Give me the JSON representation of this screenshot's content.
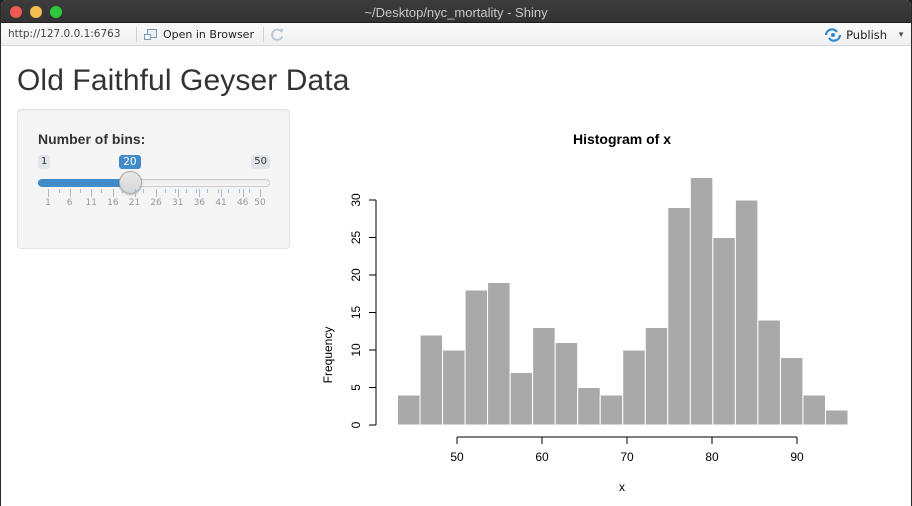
{
  "window": {
    "title": "~/Desktop/nyc_mortality - Shiny"
  },
  "toolbar": {
    "url": "http://127.0.0.1:6763",
    "open_in_browser_label": "Open in Browser",
    "publish_label": "Publish"
  },
  "page": {
    "title": "Old Faithful Geyser Data"
  },
  "slider": {
    "label": "Number of bins:",
    "min": 1,
    "max": 50,
    "value": 20,
    "min_label": "1",
    "max_label": "50",
    "value_label": "20",
    "tick_labels": [
      "1",
      "6",
      "11",
      "16",
      "21",
      "26",
      "31",
      "36",
      "41",
      "46",
      "50"
    ],
    "accent_color": "#428bca"
  },
  "chart_data": {
    "type": "bar",
    "title": "Histogram of x",
    "xlabel": "x",
    "ylabel": "Frequency",
    "bin_edges": [
      43.0,
      45.65,
      48.3,
      50.95,
      53.6,
      56.25,
      58.9,
      61.55,
      64.2,
      66.85,
      69.5,
      72.15,
      74.8,
      77.45,
      80.1,
      82.75,
      85.4,
      88.05,
      90.7,
      93.35,
      96.0
    ],
    "values": [
      4,
      12,
      10,
      18,
      19,
      7,
      13,
      11,
      5,
      4,
      10,
      13,
      29,
      33,
      25,
      30,
      14,
      9,
      4,
      2
    ],
    "x_ticks": [
      50,
      60,
      70,
      80,
      90
    ],
    "x_tick_labels": [
      "50",
      "60",
      "70",
      "80",
      "90"
    ],
    "y_ticks": [
      0,
      5,
      10,
      15,
      20,
      25,
      30
    ],
    "y_tick_labels": [
      "0",
      "5",
      "10",
      "15",
      "20",
      "25",
      "30"
    ],
    "xlim": [
      40.88,
      98.12
    ],
    "ylim": [
      0,
      33
    ],
    "bar_color": "#a9a9a9",
    "border_color": "#ffffff",
    "grid": false,
    "legend": "none"
  }
}
